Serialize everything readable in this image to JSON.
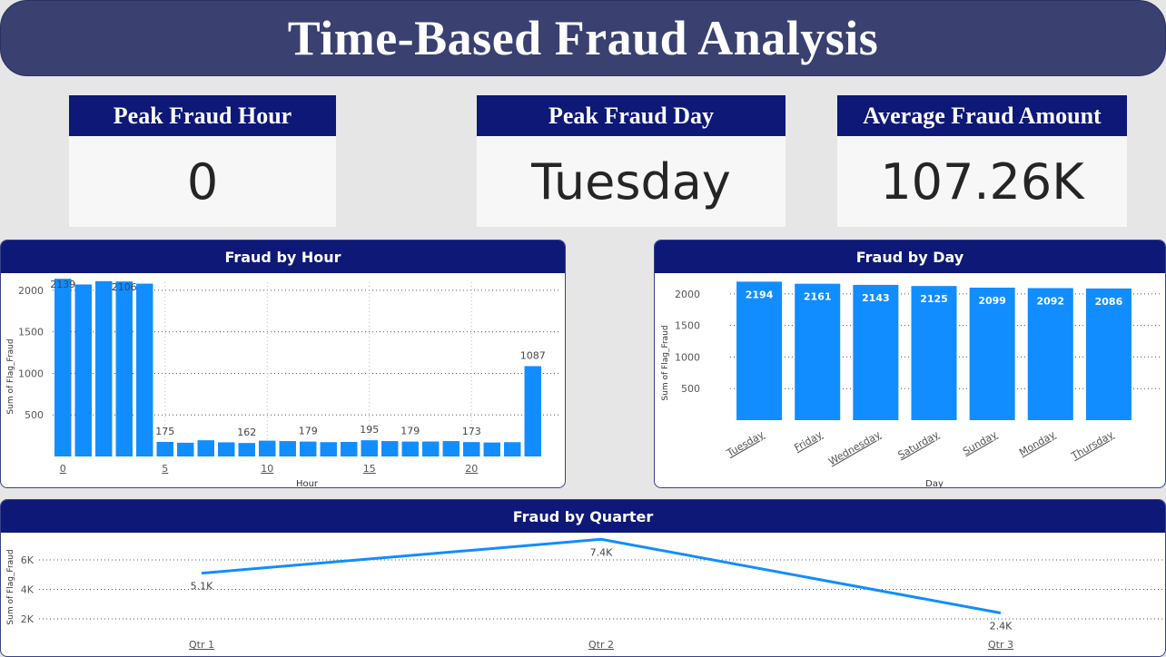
{
  "header": {
    "title": "Time-Based Fraud Analysis"
  },
  "kpis": [
    {
      "label": "Peak Fraud Hour",
      "value": "0"
    },
    {
      "label": "Peak Fraud Day",
      "value": "Tuesday"
    },
    {
      "label": "Average Fraud Amount",
      "value": "107.26K"
    }
  ],
  "colors": {
    "bar": "#118dff",
    "header": "#0e1877",
    "banner": "#3a4070"
  },
  "chart_data": [
    {
      "type": "bar",
      "title": "Fraud by Hour",
      "xlabel": "Hour",
      "ylabel": "Sum of Flag_Fraud",
      "x": [
        0,
        1,
        2,
        3,
        4,
        5,
        6,
        7,
        8,
        9,
        10,
        11,
        12,
        13,
        14,
        15,
        16,
        17,
        18,
        19,
        20,
        21,
        22,
        23
      ],
      "values": [
        2139,
        2070,
        2110,
        2106,
        2080,
        175,
        165,
        195,
        170,
        162,
        190,
        185,
        179,
        172,
        175,
        195,
        185,
        179,
        180,
        185,
        173,
        168,
        172,
        1087
      ],
      "data_labels": [
        {
          "x": 0,
          "label": "2139"
        },
        {
          "x": 3,
          "label": "2106"
        },
        {
          "x": 5,
          "label": "175"
        },
        {
          "x": 9,
          "label": "162"
        },
        {
          "x": 12,
          "label": "179"
        },
        {
          "x": 15,
          "label": "195"
        },
        {
          "x": 17,
          "label": "179"
        },
        {
          "x": 20,
          "label": "173"
        },
        {
          "x": 23,
          "label": "1087"
        }
      ],
      "x_ticks": [
        "0",
        "5",
        "10",
        "15",
        "20"
      ],
      "y_ticks": [
        "500",
        "1000",
        "1500",
        "2000"
      ],
      "ylim": [
        0,
        2250
      ],
      "grid": true
    },
    {
      "type": "bar",
      "title": "Fraud by Day",
      "xlabel": "Day",
      "ylabel": "Sum of Flag_Fraud",
      "categories": [
        "Tuesday",
        "Friday",
        "Wednesday",
        "Saturday",
        "Sunday",
        "Monday",
        "Thursday"
      ],
      "values": [
        2194,
        2161,
        2143,
        2125,
        2099,
        2092,
        2086
      ],
      "y_ticks": [
        "500",
        "1000",
        "1500",
        "2000"
      ],
      "ylim": [
        0,
        2300
      ],
      "grid": true
    },
    {
      "type": "line",
      "title": "Fraud by Quarter",
      "ylabel": "Sum of Flag_Fraud",
      "categories": [
        "Qtr 1",
        "Qtr 2",
        "Qtr 3"
      ],
      "values": [
        5100,
        7400,
        2400
      ],
      "data_labels": [
        "5.1K",
        "7.4K",
        "2.4K"
      ],
      "y_ticks": [
        "2K",
        "4K",
        "6K"
      ],
      "ylim": [
        0,
        8000
      ],
      "grid": true
    }
  ]
}
